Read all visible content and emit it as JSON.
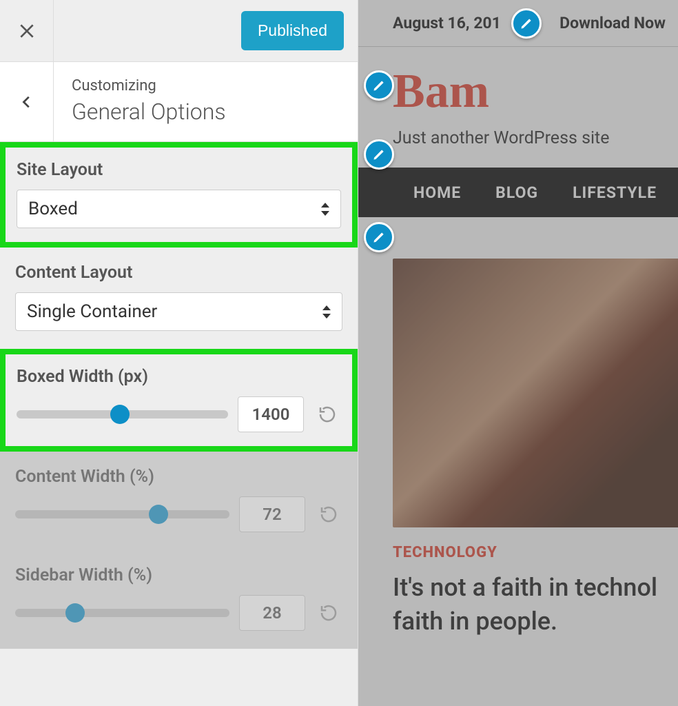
{
  "customizer": {
    "published_label": "Published",
    "breadcrumb": "Customizing",
    "section_title": "General Options",
    "site_layout": {
      "label": "Site Layout",
      "value": "Boxed"
    },
    "content_layout": {
      "label": "Content Layout",
      "value": "Single Container"
    },
    "boxed_width": {
      "label": "Boxed Width (px)",
      "value": "1400",
      "thumb_pct": 49
    },
    "content_width": {
      "label": "Content Width (%)",
      "value": "72",
      "thumb_pct": 67
    },
    "sidebar_width": {
      "label": "Sidebar Width (%)",
      "value": "28",
      "thumb_pct": 28
    }
  },
  "preview": {
    "date": "August 16, 201",
    "download": "Download Now",
    "site_title": "Bam",
    "tagline": "Just another WordPress site",
    "nav": {
      "home": "HOME",
      "blog": "BLOG",
      "lifestyle": "LIFESTYLE"
    },
    "article": {
      "category": "TECHNOLOGY",
      "title": "It's not a faith in technol\nfaith in people."
    }
  }
}
